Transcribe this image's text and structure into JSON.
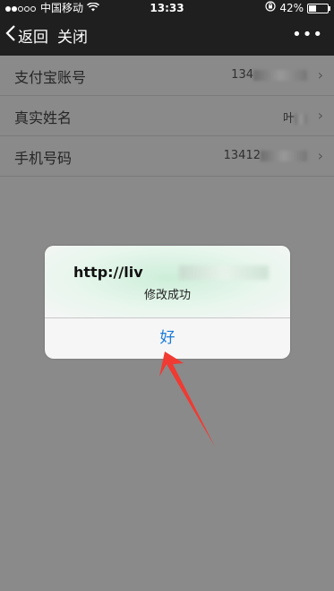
{
  "status_bar": {
    "carrier": "中国移动",
    "time": "13:33",
    "battery": "42%",
    "battery_level": 0.42
  },
  "nav": {
    "back_label": "返回",
    "close_label": "关闭",
    "more_label": "•••"
  },
  "rows": [
    {
      "label": "支付宝账号",
      "value": "134"
    },
    {
      "label": "真实姓名",
      "value": "叶"
    },
    {
      "label": "手机号码",
      "value": "13412"
    }
  ],
  "alert": {
    "title": "http://liv",
    "message": "修改成功",
    "ok_label": "好"
  },
  "colors": {
    "accent": "#1a7bd9",
    "arrow": "#f03a32"
  }
}
